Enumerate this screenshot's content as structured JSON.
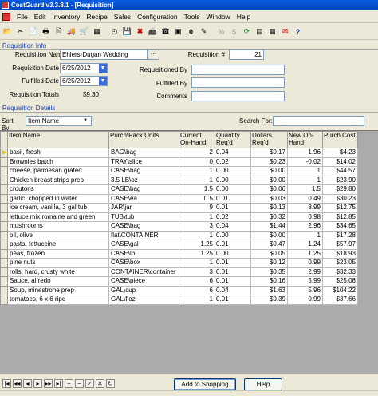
{
  "window": {
    "title": "CostGuard v3.3.8.1 - [Requisition]"
  },
  "menu": [
    "File",
    "Edit",
    "Inventory",
    "Recipe",
    "Sales",
    "Configuration",
    "Tools",
    "Window",
    "Help"
  ],
  "toolbar_icons": [
    "open-icon",
    "cut-icon",
    "recipe-icon",
    "print-icon",
    "print-preview-icon",
    "vendor-icon",
    "cart-icon",
    "calculator-icon",
    "timer-icon",
    "save-icon",
    "delete-icon",
    "fax-icon",
    "phone-icon",
    "image-icon",
    "number-icon",
    "edit-icon",
    "percent-icon",
    "dollar-icon",
    "refresh-icon",
    "spreadsheet-icon",
    "calendar-icon",
    "pdf-icon",
    "help-icon"
  ],
  "info": {
    "section": "Requisition Info",
    "requisition_name_label": "Requisition Name",
    "requisition_name": "Ehlers-Dugan Wedding",
    "requisition_no_label": "Requisition #",
    "requisition_no": "21",
    "requisition_date_label": "Requisition Date",
    "requisition_date": "6/25/2012",
    "requisitioned_by_label": "Requisitioned By",
    "requisitioned_by": "",
    "fulfilled_date_label": "Fulfilled Date",
    "fulfilled_date": "6/25/2012",
    "fulfilled_by_label": "Fulfilled By",
    "fulfilled_by": "",
    "totals_label": "Requisition Totals",
    "totals": "$9.30",
    "comments_label": "Comments",
    "comments": ""
  },
  "details": {
    "section": "Requisition Details",
    "sort_label": "Sort By:",
    "sort_value": "Item Name",
    "search_label": "Search For:",
    "search_value": ""
  },
  "table": {
    "headers": [
      "Item Name",
      "Purch\\Pack Units",
      "Current On-Hand",
      "Quantity Req'd",
      "Dollars Req'd",
      "New On-Hand",
      "Purch Cost"
    ],
    "rows": [
      [
        "basil, fresh",
        "BAG\\bag",
        "2",
        "0.04",
        "$0.17",
        "1.96",
        "$4.23"
      ],
      [
        "Brownies batch",
        "TRAY\\slice",
        "0",
        "0.02",
        "$0.23",
        "-0.02",
        "$14.02"
      ],
      [
        "cheese, parmesan grated",
        "CASE\\bag",
        "1",
        "0.00",
        "$0.00",
        "1",
        "$44.57"
      ],
      [
        "Chicken breast strips prep",
        "3.5 LB\\oz",
        "1",
        "0.00",
        "$0.00",
        "1",
        "$23.90"
      ],
      [
        "croutons",
        "CASE\\bag",
        "1.5",
        "0.00",
        "$0.06",
        "1.5",
        "$29.80"
      ],
      [
        "garlic, chopped in water",
        "CASE\\ea",
        "0.5",
        "0.01",
        "$0.03",
        "0.49",
        "$30.23"
      ],
      [
        "ice cream, vanilla, 3 gal tub",
        "JAR\\jar",
        "9",
        "0.01",
        "$0.13",
        "8.99",
        "$12.75"
      ],
      [
        "lettuce mix romaine and green",
        "TUB\\tub",
        "1",
        "0.02",
        "$0.32",
        "0.98",
        "$12.85"
      ],
      [
        "mushrooms",
        "CASE\\bag",
        "3",
        "0.04",
        "$1.44",
        "2.96",
        "$34.65"
      ],
      [
        "oil, olive",
        "flat\\CONTAINER",
        "1",
        "0.00",
        "$0.00",
        "1",
        "$17.28"
      ],
      [
        "pasta, fettuccine",
        "CASE\\gal",
        "1.25",
        "0.01",
        "$0.47",
        "1.24",
        "$57.97"
      ],
      [
        "peas, frozen",
        "CASE\\lb",
        "1.25",
        "0.00",
        "$0.05",
        "1.25",
        "$18.93"
      ],
      [
        "pine nuts",
        "CASE\\box",
        "1",
        "0.01",
        "$0.12",
        "0.99",
        "$23.05"
      ],
      [
        "rolls, hard, crusty white",
        "CONTAINER\\container",
        "3",
        "0.01",
        "$0.35",
        "2.99",
        "$32.33"
      ],
      [
        "Sauce, alfredo",
        "CASE\\piece",
        "6",
        "0.01",
        "$0.16",
        "5.99",
        "$25.08"
      ],
      [
        "Soup, minestrone prep",
        "GAL\\cup",
        "6",
        "0.04",
        "$1.63",
        "5.96",
        "$104.22"
      ],
      [
        "tomatoes, 6 x 6 ripe",
        "GAL\\floz",
        "1",
        "0.01",
        "$0.39",
        "0.99",
        "$37.66"
      ]
    ]
  },
  "buttons": {
    "add_to_cart": "Add to Shopping Cart",
    "help": "Help"
  }
}
